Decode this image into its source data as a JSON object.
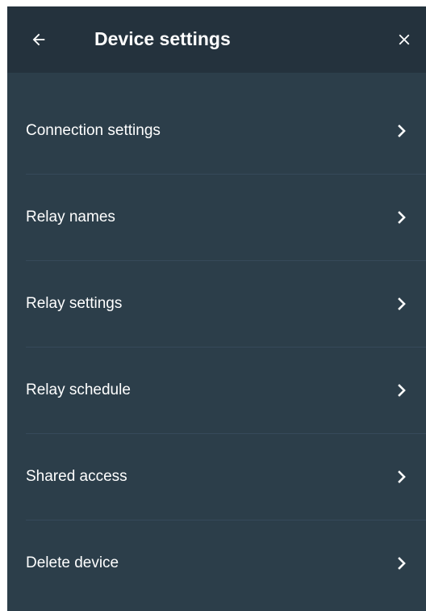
{
  "header": {
    "title": "Device settings",
    "back_icon": "arrow-left-icon",
    "close_icon": "close-icon"
  },
  "menu": {
    "items": [
      {
        "id": "connection-settings",
        "label": "Connection settings"
      },
      {
        "id": "relay-names",
        "label": "Relay names"
      },
      {
        "id": "relay-settings",
        "label": "Relay settings"
      },
      {
        "id": "relay-schedule",
        "label": "Relay schedule"
      },
      {
        "id": "shared-access",
        "label": "Shared access"
      },
      {
        "id": "delete-device",
        "label": "Delete device"
      }
    ],
    "chevron_icon": "chevron-right-icon"
  },
  "colors": {
    "background": "#2c3e4a",
    "header": "#24323d",
    "divider": "#36495a",
    "text": "#ffffff"
  }
}
